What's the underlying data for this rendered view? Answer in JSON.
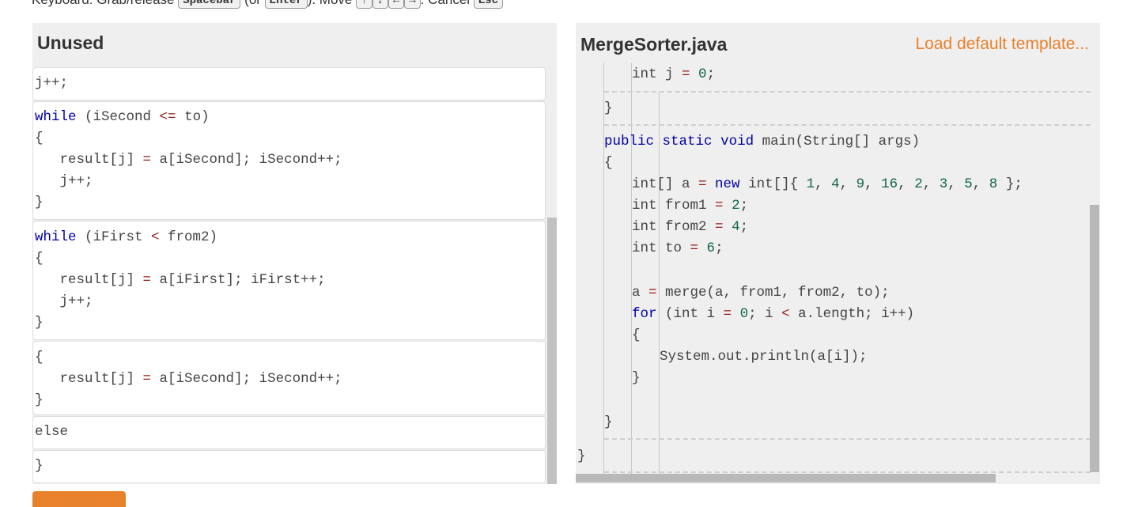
{
  "instructions": {
    "prefix": "Keyboard: Grab/release ",
    "key_space": "Spacebar",
    "mid1": " (or ",
    "key_enter": "Enter",
    "mid2": "). Move ",
    "key_up": "↑",
    "key_down": "↓",
    "key_left": "←",
    "key_right": "→",
    "mid3": ". Cancel ",
    "key_esc": "Esc"
  },
  "unused": {
    "title": "Unused",
    "blocks": [
      {
        "lines": [
          "j++;"
        ]
      },
      {
        "lines": [
          "while (iSecond <= to)",
          "{",
          "   result[j] = a[iSecond]; iSecond++;",
          "   j++;",
          "}"
        ]
      },
      {
        "lines": [
          "while (iFirst < from2)",
          "{",
          "   result[j] = a[iFirst]; iFirst++;",
          "   j++;",
          "}"
        ]
      },
      {
        "lines": [
          "{",
          "   result[j] = a[iSecond]; iSecond++;",
          "}"
        ]
      },
      {
        "lines": [
          "else"
        ]
      },
      {
        "lines": [
          "}"
        ]
      }
    ]
  },
  "editor": {
    "title": "MergeSorter.java",
    "load_template": "Load default template...",
    "lines": [
      "int j = 0;",
      "}",
      "public static void main(String[] args)",
      "{",
      "int[] a = new int[]{ 1, 4, 9, 16, 2, 3, 5, 8 };",
      "int from1 = 2;",
      "int from2 = 4;",
      "int to = 6;",
      "a = merge(a, from1, from2, to);",
      "for (int i = 0; i < a.length; i++)",
      "{",
      "System.out.println(a[i]);",
      "}",
      "}",
      "}"
    ]
  },
  "colors": {
    "accent": "#e8812b",
    "keyword": "#0000a8",
    "number": "#116644",
    "operator": "#981a1a"
  }
}
